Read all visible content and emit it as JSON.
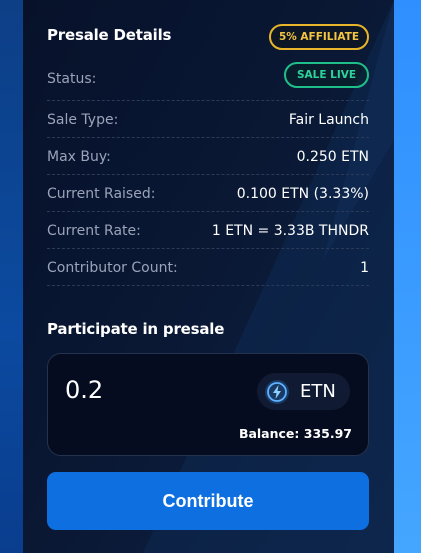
{
  "presale": {
    "title": "Presale Details",
    "affiliate_badge": "5% AFFILIATE",
    "status_label": "Status:",
    "status_badge": "SALE LIVE",
    "rows": [
      {
        "label": "Sale Type:",
        "value": "Fair Launch"
      },
      {
        "label": "Max Buy:",
        "value": "0.250 ETN"
      },
      {
        "label": "Current Raised:",
        "value": "0.100 ETN (3.33%)"
      },
      {
        "label": "Current Rate:",
        "value": "1 ETN = 3.33B THNDR"
      },
      {
        "label": "Contributor Count:",
        "value": "1"
      }
    ]
  },
  "participate": {
    "title": "Participate in presale",
    "amount": "0.2",
    "token": "ETN",
    "token_icon": "lightning-icon",
    "balance": "Balance: 335.97",
    "contribute_label": "Contribute"
  },
  "colors": {
    "accent": "#0e6fe0",
    "affiliate": "#e8b52b",
    "live": "#1fbf8a"
  }
}
